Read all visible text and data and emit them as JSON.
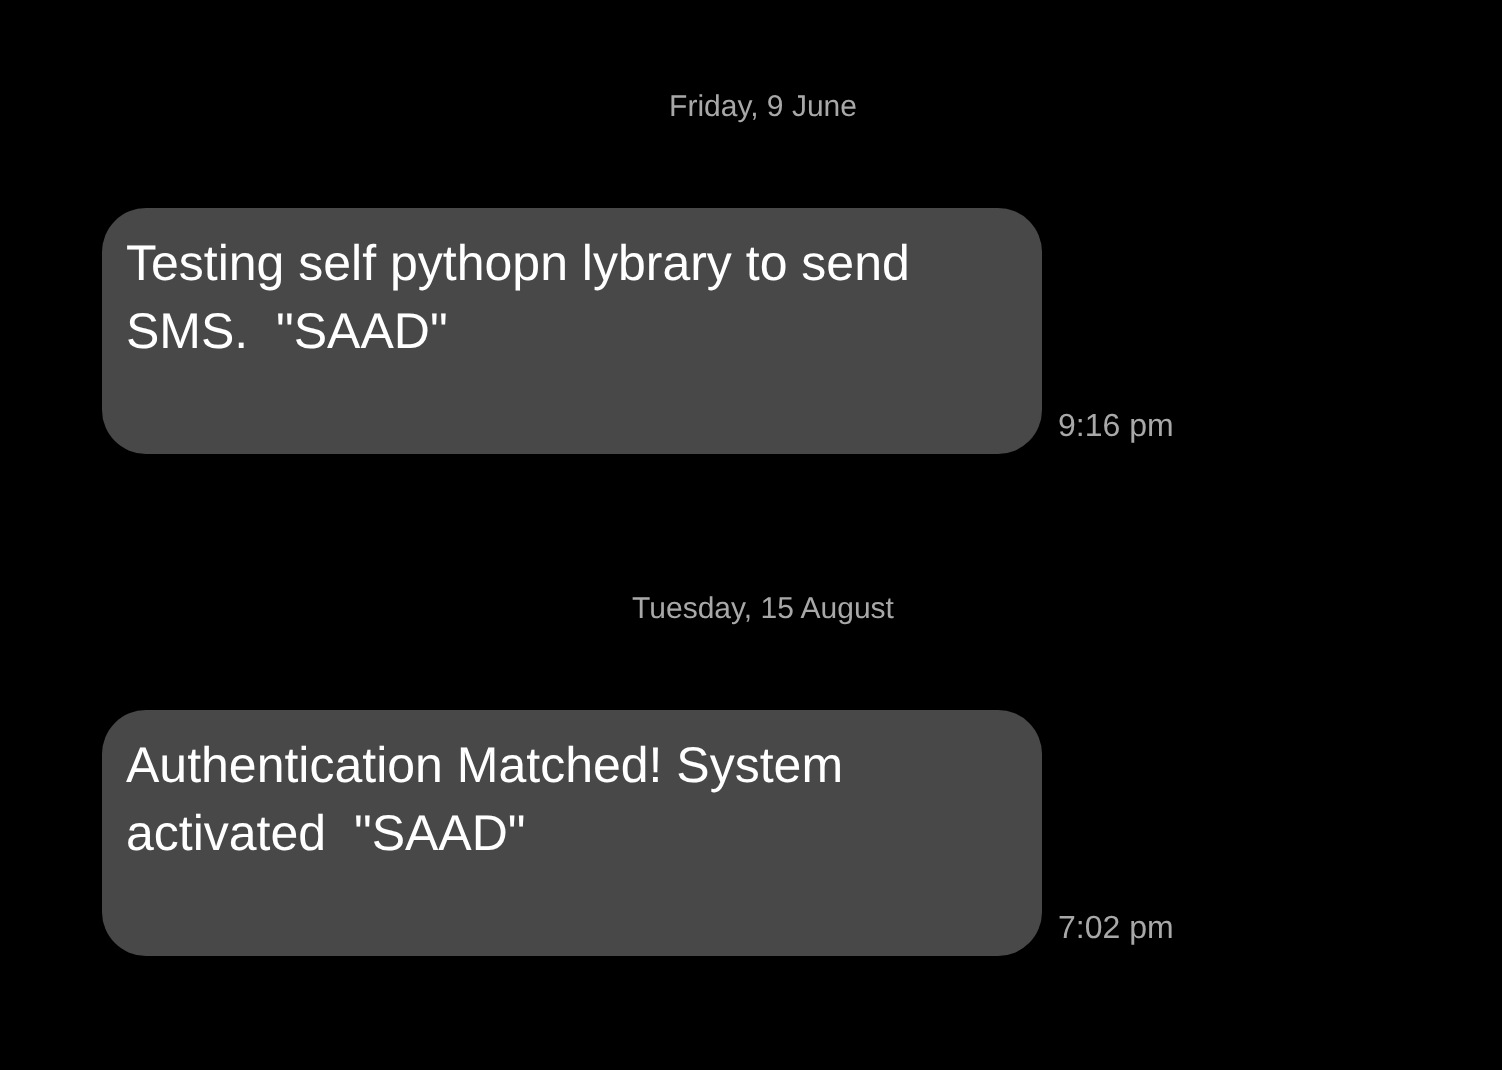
{
  "conversation": [
    {
      "date": "Friday, 9 June",
      "message": {
        "text": "Testing self pythopn lybrary to send SMS.  \"SAAD\"",
        "time": "9:16 pm"
      }
    },
    {
      "date": "Tuesday, 15 August",
      "message": {
        "text": "Authentication Matched! System activated  \"SAAD\"",
        "time": "7:02 pm"
      }
    }
  ]
}
